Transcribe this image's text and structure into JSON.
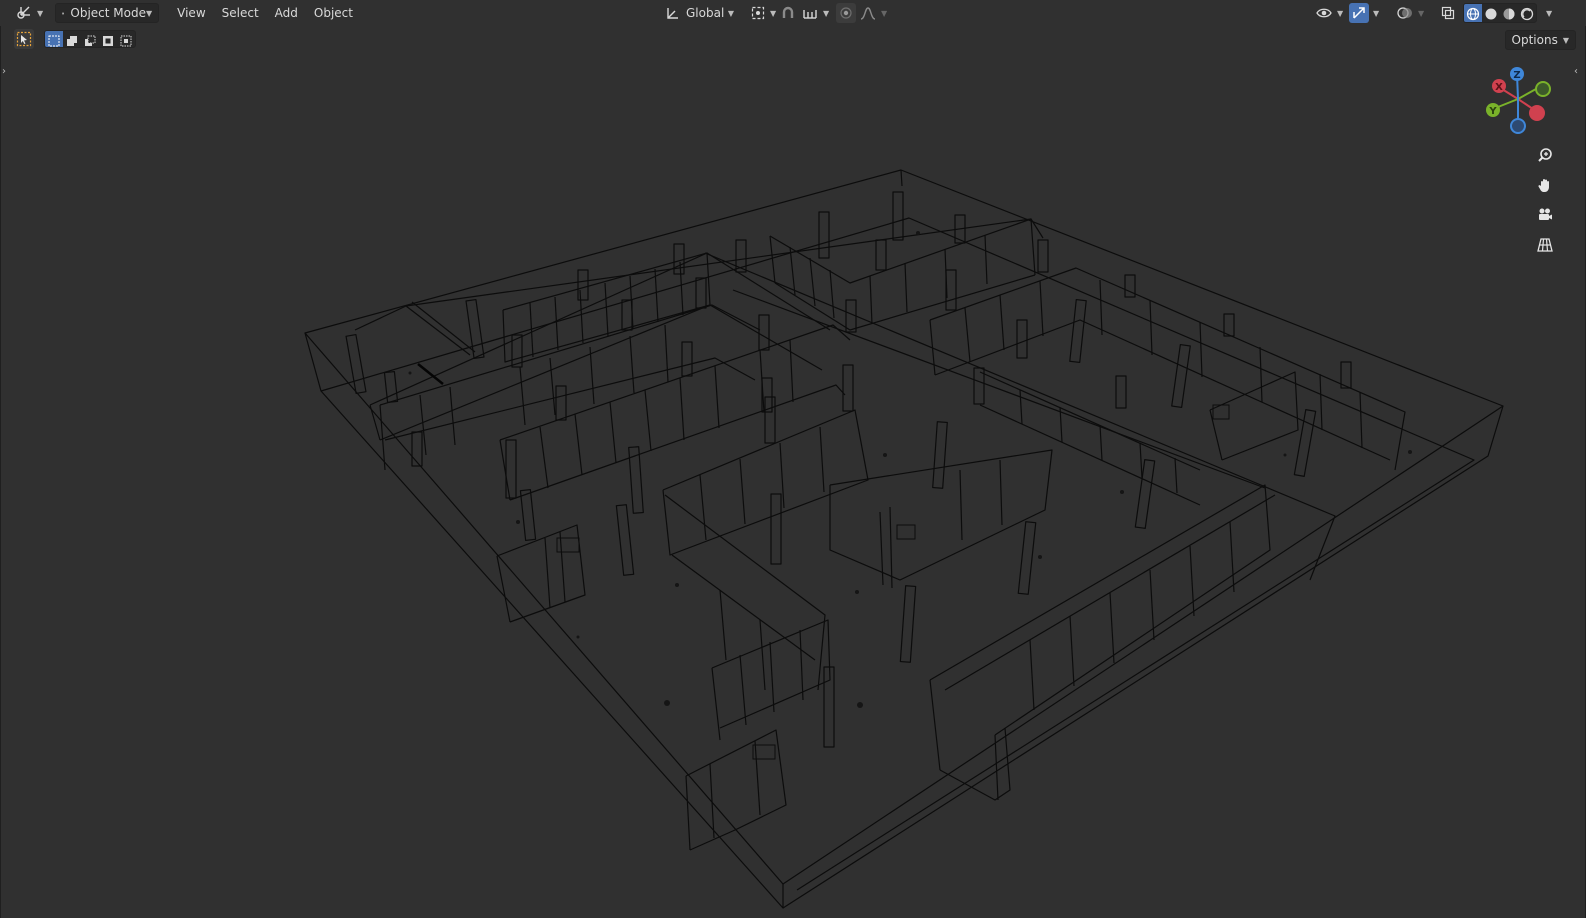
{
  "header": {
    "editor_type_icon": "editor-type-icon",
    "mode": {
      "label": "Object Mode",
      "icon": "object-mode-icon"
    },
    "menus": [
      "View",
      "Select",
      "Add",
      "Object"
    ],
    "transform_orientation": {
      "label": "Global",
      "icon": "transform-orientation-icon"
    },
    "pivot_icon": "pivot-point-icon",
    "snap_icon": "snap-icon",
    "snap_target_icon": "snap-increment-icon",
    "proportional_icon": "proportional-editing-icon",
    "falloff_icon": "falloff-curve-icon",
    "right_icons": [
      "visibility-icon",
      "gizmo-icon",
      "overlays-icon",
      "xray-icon"
    ],
    "shading_modes": [
      {
        "name": "wireframe",
        "active": true
      },
      {
        "name": "solid",
        "active": false
      },
      {
        "name": "material-preview",
        "active": false
      },
      {
        "name": "rendered",
        "active": false
      }
    ]
  },
  "subheader": {
    "tool_icon": "select-box-tool-icon",
    "selection_modes": [
      "set-selection-icon",
      "extend-selection-icon",
      "subtract-selection-icon",
      "invert-selection-icon",
      "intersect-selection-icon"
    ],
    "options_label": "Options"
  },
  "navigation": {
    "axes": {
      "x": "X",
      "y": "Y",
      "z": "Z"
    },
    "tools": [
      "zoom-icon",
      "pan-hand-icon",
      "camera-view-icon",
      "orthographic-grid-icon"
    ]
  },
  "colors": {
    "background": "#303030",
    "header": "#303030",
    "wire": "#000000",
    "accent": "#4772b3",
    "axis_x": "#d0414f",
    "axis_y": "#7ab22a",
    "axis_z": "#3f87d9"
  }
}
